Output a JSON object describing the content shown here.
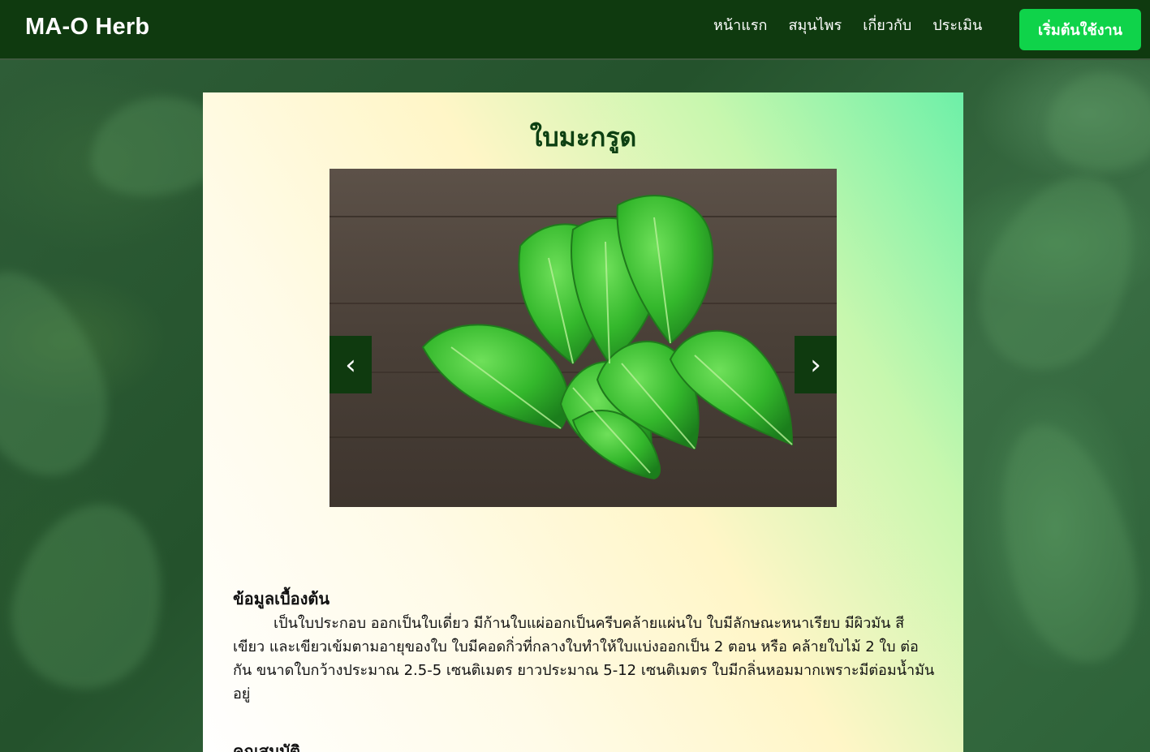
{
  "navbar": {
    "brand": "MA-O Herb",
    "links": [
      {
        "label": "หน้าแรก"
      },
      {
        "label": "สมุนไพร"
      },
      {
        "label": "เกี่ยวกับ"
      },
      {
        "label": "ประเมิน"
      }
    ],
    "cta_label": "เริ่มต้นใช้งาน"
  },
  "herb": {
    "title": "ใบมะกรูด",
    "carousel": {
      "prev_symbol": "‹",
      "next_symbol": "›"
    },
    "sections": [
      {
        "heading": "ข้อมูลเบื้องต้น",
        "body": "เป็นใบประกอบ ออกเป็นใบเดี่ยว มีก้านใบแผ่ออกเป็นครีบคล้ายแผ่นใบ ใบมีลักษณะหนาเรียบ มีผิวมัน สีเขียว และเขียวเข้มตามอายุของใบ ใบมีคอดกิ่วที่กลางใบทำให้ใบแบ่งออกเป็น 2 ตอน หรือ คล้ายใบไม้ 2 ใบ ต่อกัน ขนาดใบกว้างประมาณ 2.5-5 เซนติเมตร ยาวประมาณ 5-12 เซนติเมตร ใบมีกลิ่นหอมมากเพราะมีต่อมน้ำมันอยู่"
      },
      {
        "heading": "คุณสมบัติ"
      }
    ]
  },
  "colors": {
    "navbar_bg": "#0f3a0f",
    "cta_bg": "#0fd34a",
    "title_color": "#0d4012"
  }
}
